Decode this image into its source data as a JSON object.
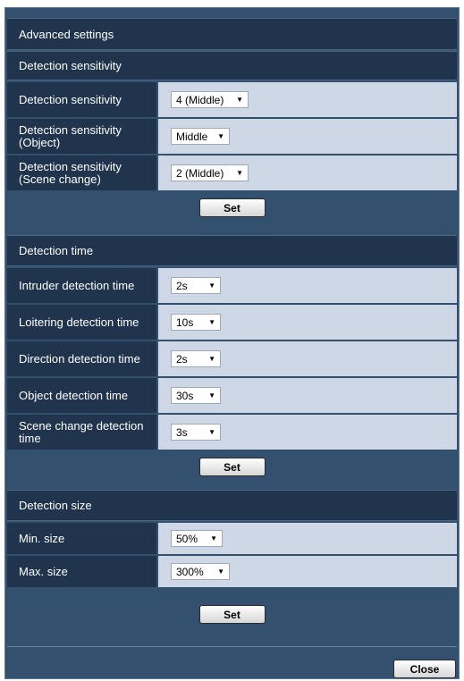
{
  "title": "Advanced settings",
  "sensitivity": {
    "header": "Detection sensitivity",
    "rows": [
      {
        "label": "Detection sensitivity",
        "value": "4 (Middle)"
      },
      {
        "label": "Detection sensitivity (Object)",
        "value": "Middle"
      },
      {
        "label": "Detection sensitivity (Scene change)",
        "value": "2 (Middle)"
      }
    ],
    "set_label": "Set"
  },
  "time": {
    "header": "Detection time",
    "rows": [
      {
        "label": "Intruder detection time",
        "value": "2s"
      },
      {
        "label": "Loitering detection time",
        "value": "10s"
      },
      {
        "label": "Direction detection time",
        "value": "2s"
      },
      {
        "label": "Object detection time",
        "value": "30s"
      },
      {
        "label": "Scene change detection time",
        "value": "3s"
      }
    ],
    "set_label": "Set"
  },
  "size": {
    "header": "Detection size",
    "rows": [
      {
        "label": "Min. size",
        "value": "50%"
      },
      {
        "label": "Max. size",
        "value": "300%"
      }
    ],
    "set_label": "Set"
  },
  "close_label": "Close"
}
